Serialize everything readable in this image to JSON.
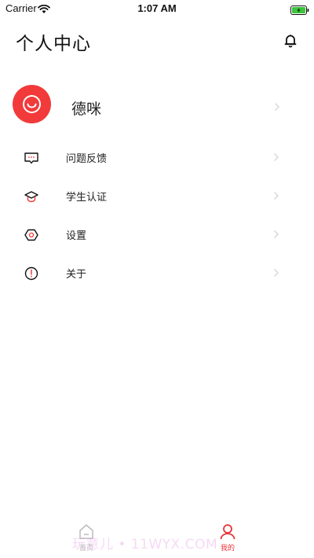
{
  "status_bar": {
    "carrier": "Carrier",
    "time": "1:07 AM"
  },
  "header": {
    "title": "个人中心",
    "notification_icon": "bell-icon"
  },
  "profile": {
    "name": "德咪",
    "avatar_icon": "smile-face-icon",
    "avatar_color": "#f23a3a"
  },
  "menu": {
    "items": [
      {
        "label": "问题反馈",
        "icon": "feedback-chat-icon"
      },
      {
        "label": "学生认证",
        "icon": "graduation-cap-icon"
      },
      {
        "label": "设置",
        "icon": "settings-hexagon-icon"
      },
      {
        "label": "关于",
        "icon": "info-exclamation-icon"
      }
    ]
  },
  "tab_bar": {
    "tabs": [
      {
        "label": "首页",
        "icon": "home-icon",
        "active": false
      },
      {
        "label": "我的",
        "icon": "person-icon",
        "active": true
      }
    ],
    "active_color": "#e8343a",
    "inactive_color": "#bbbbbb"
  },
  "watermark": "玩意儿 • 11WYX.COM"
}
